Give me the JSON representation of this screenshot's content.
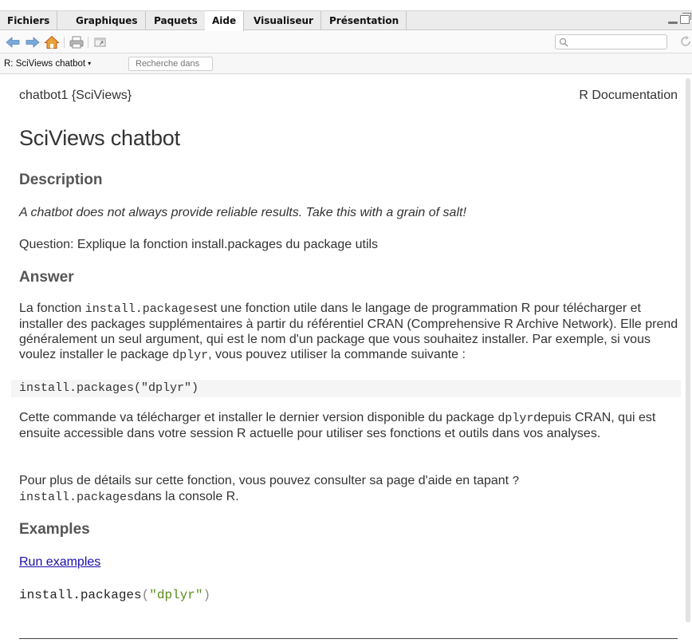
{
  "tabs": [
    {
      "label": "Fichiers",
      "active": false
    },
    {
      "label": "Graphiques",
      "active": false
    },
    {
      "label": "Paquets",
      "active": false
    },
    {
      "label": "Aide",
      "active": true
    },
    {
      "label": "Visualiseur",
      "active": false
    },
    {
      "label": "Présentation",
      "active": false
    }
  ],
  "toolbar": {
    "icons": [
      "back-arrow-icon",
      "forward-arrow-icon",
      "home-icon",
      "print-icon",
      "new-window-icon"
    ],
    "search_value": "",
    "refresh_icon": "refresh-icon"
  },
  "subbar": {
    "topic": "R: SciViews chatbot",
    "find_placeholder": "Recherche dans"
  },
  "doc": {
    "header_left": "chatbot1 {SciViews}",
    "header_right": "R Documentation",
    "title": "SciViews chatbot",
    "description_heading": "Description",
    "description_text": "A chatbot does not always provide reliable results. Take this with a grain of salt!",
    "question": "Question: Explique la fonction install.packages du package utils",
    "answer_heading": "Answer",
    "answer_p1": {
      "t1": "La fonction ",
      "c1": "install.packages",
      "t2": "est une fonction utile dans le langage de programmation R pour télécharger et installer des packages supplémentaires à partir du référentiel CRAN (Comprehensive R Archive Network). Elle prend généralement un seul argument, qui est le nom d'un package que vous souhaitez installer. Par exemple, si vous voulez installer le package ",
      "c2": "dplyr",
      "t3": ", vous pouvez utiliser la commande suivante :"
    },
    "code_block": "install.packages(\"dplyr\")",
    "answer_p2": {
      "t1": "Cette commande va télécharger et installer le dernier version disponible du package ",
      "c1": "dplyr",
      "t2": "depuis CRAN, qui est ensuite accessible dans votre session R actuelle pour utiliser ses fonctions et outils dans vos analyses."
    },
    "answer_p3": {
      "t1": "Pour plus de détails sur cette fonction, vous pouvez consulter sa page d'aide en tapant ",
      "c1": "? install.packages",
      "t2": "dans la console R."
    },
    "examples_heading": "Examples",
    "run_examples": "Run examples",
    "example_code": {
      "fn": "install.packages",
      "open": "(",
      "str": "\"dplyr\"",
      "close": ")"
    }
  },
  "colors": {
    "link": "#1a0dab",
    "string": "#5e8c1e",
    "heading": "#555555",
    "code_bg": "#f5f5f5"
  }
}
